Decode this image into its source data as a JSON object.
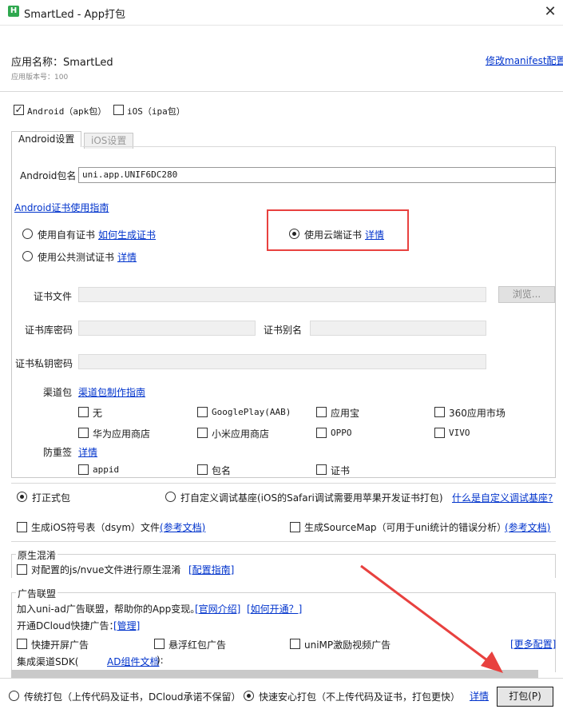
{
  "window": {
    "title": "SmartLed - App打包",
    "icon_text": "H"
  },
  "app": {
    "name_label": "应用名称：SmartLed",
    "version_label": "应用版本号：100",
    "manifest_link": "修改manifest配置"
  },
  "platforms": {
    "android_label": "Android（apk包）",
    "android_checked": true,
    "ios_label": "iOS（ipa包）",
    "ios_checked": false
  },
  "tabs": [
    {
      "label": "Android设置",
      "active": true
    },
    {
      "label": "iOS设置",
      "active": false
    }
  ],
  "android": {
    "package_label": "Android包名",
    "package_value": "uni.app.UNIF6DC280",
    "cert_guide_link": "Android证书使用指南",
    "own_cert_label": "使用自有证书",
    "own_cert_link": "如何生成证书",
    "public_cert_label": "使用公共测试证书",
    "public_cert_link": "详情",
    "cloud_cert_label": "使用云端证书",
    "cloud_cert_link": "详情",
    "selected_cert": "cloud",
    "cert_file_label": "证书文件",
    "browse_label": "浏览...",
    "keystore_pwd_label": "证书库密码",
    "alias_label": "证书别名",
    "private_key_label": "证书私钥密码",
    "channel_label": "渠道包",
    "channel_link": "渠道包制作指南",
    "channels": [
      "无",
      "GooglePlay(AAB)",
      "应用宝",
      "360应用市场",
      "华为应用商店",
      "小米应用商店",
      "OPPO",
      "VIVO"
    ],
    "anti_label": "防重签",
    "anti_link": "详情",
    "anti_options": [
      "appid",
      "包名",
      "证书"
    ]
  },
  "build": {
    "formal_label": "打正式包",
    "custom_base_label": "打自定义调试基座(iOS的Safari调试需要用苹果开发证书打包)",
    "custom_base_link": "什么是自定义调试基座?",
    "selected": "formal",
    "dsym_label": "生成iOS符号表（dsym）文件",
    "dsym_link": "(参考文档)",
    "sourcemap_label": "生成SourceMap（可用于uni统计的错误分析）",
    "sourcemap_link": "(参考文档)"
  },
  "obfuscation": {
    "title": "原生混淆",
    "label": "对配置的js/nvue文件进行原生混淆",
    "link": "[配置指南]"
  },
  "ads": {
    "title": "广告联盟",
    "intro": "加入uni-ad广告联盟，帮助你的App变现。",
    "intro_link1": "[官网介绍]",
    "intro_link2": "[如何开通？]",
    "quick_label": "开通DCloud快捷广告：",
    "quick_link": "[管理]",
    "splash_label": "快捷开屏广告",
    "float_label": "悬浮红包广告",
    "video_label": "uniMP激励视频广告",
    "more_link": "[更多配置]",
    "sdk_prefix": "集成渠道SDK(",
    "sdk_link": "AD组件文档",
    "sdk_suffix": "):"
  },
  "footer": {
    "traditional_label": "传统打包（上传代码及证书，DCloud承诺不保留）",
    "fast_label": "快速安心打包（不上传代码及证书，打包更快）",
    "selected": "fast",
    "detail_link": "详情",
    "pack_button": "打包(P)"
  },
  "colors": {
    "link": "#0033cc",
    "highlight": "#e8413f",
    "arrow": "#e8413f"
  }
}
